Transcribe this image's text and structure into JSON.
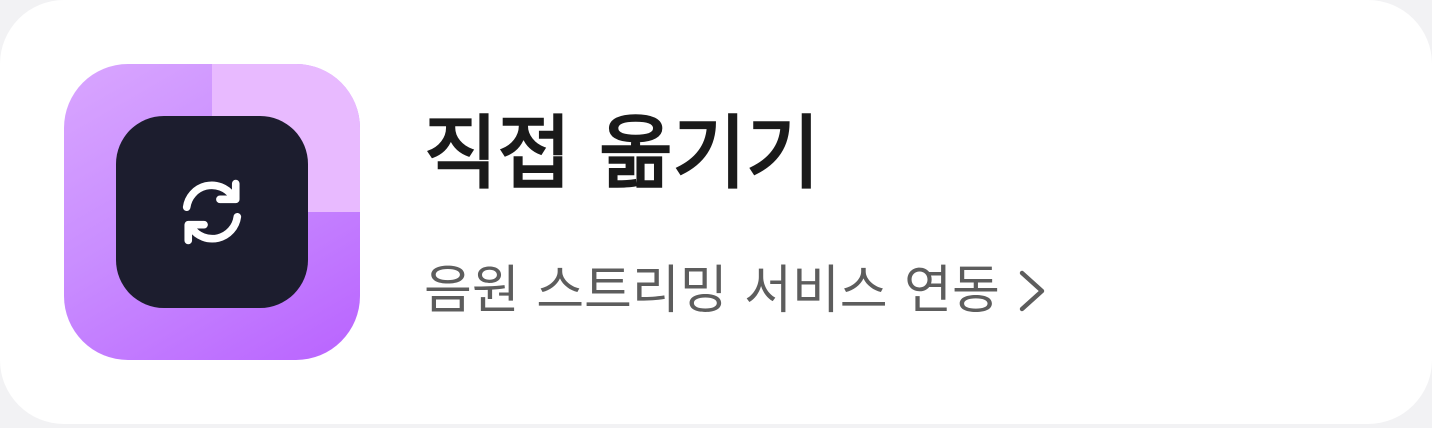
{
  "card": {
    "title": "직접 옮기기",
    "subtitle": "음원 스트리밍 서비스 연동",
    "icon": "sync-icon",
    "link_icon": "chevron-right-icon",
    "colors": {
      "icon_gradient_start": "#d9a6ff",
      "icon_gradient_end": "#b963ff",
      "icon_inner": "#1c1d2e",
      "title": "#1a1a1a",
      "subtitle": "#5d5d5d"
    }
  }
}
